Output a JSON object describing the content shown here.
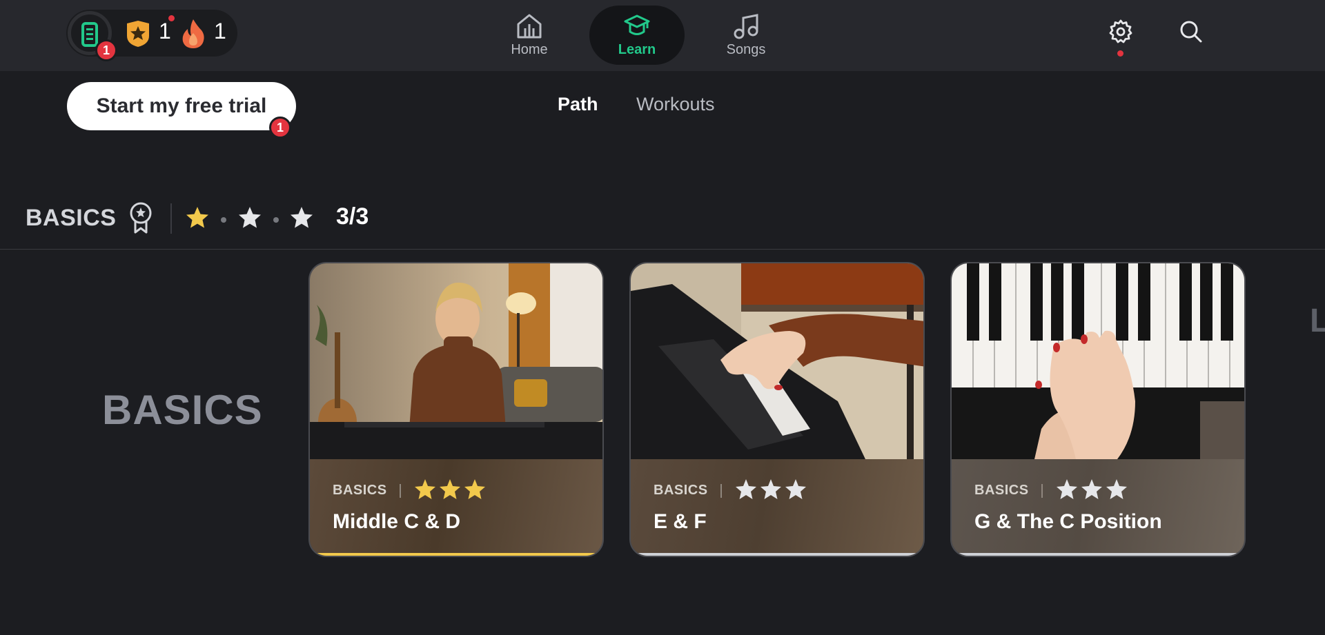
{
  "colors": {
    "accent": "#22c98b",
    "gold": "#f2c94c",
    "badge": "#e3343f"
  },
  "header": {
    "progress_badge": "1",
    "stars_count": "1",
    "streak_count": "1",
    "nav": [
      {
        "label": "Home",
        "icon": "home-icon"
      },
      {
        "label": "Learn",
        "icon": "graduation-cap-icon",
        "active": true
      },
      {
        "label": "Songs",
        "icon": "music-note-icon"
      }
    ]
  },
  "trial": {
    "label": "Start my free trial",
    "badge": "1"
  },
  "tabs": {
    "path": "Path",
    "workouts": "Workouts"
  },
  "section": {
    "title": "BASICS",
    "stars_earned": 1,
    "stars_total": 3,
    "count": "3/3"
  },
  "big_title": "BASICS",
  "cards": [
    {
      "category": "BASICS",
      "title": "Middle C & D",
      "stars": 3,
      "progress": 1.0,
      "image": "teacher-at-piano"
    },
    {
      "category": "BASICS",
      "title": "E & F",
      "stars": 0,
      "progress": 1.0,
      "image": "hand-on-piano-keys"
    },
    {
      "category": "BASICS",
      "title": "G & The C Position",
      "stars": 0,
      "progress": 1.0,
      "image": "hands-on-keyboard-top-view"
    }
  ],
  "edge_letter": "L"
}
